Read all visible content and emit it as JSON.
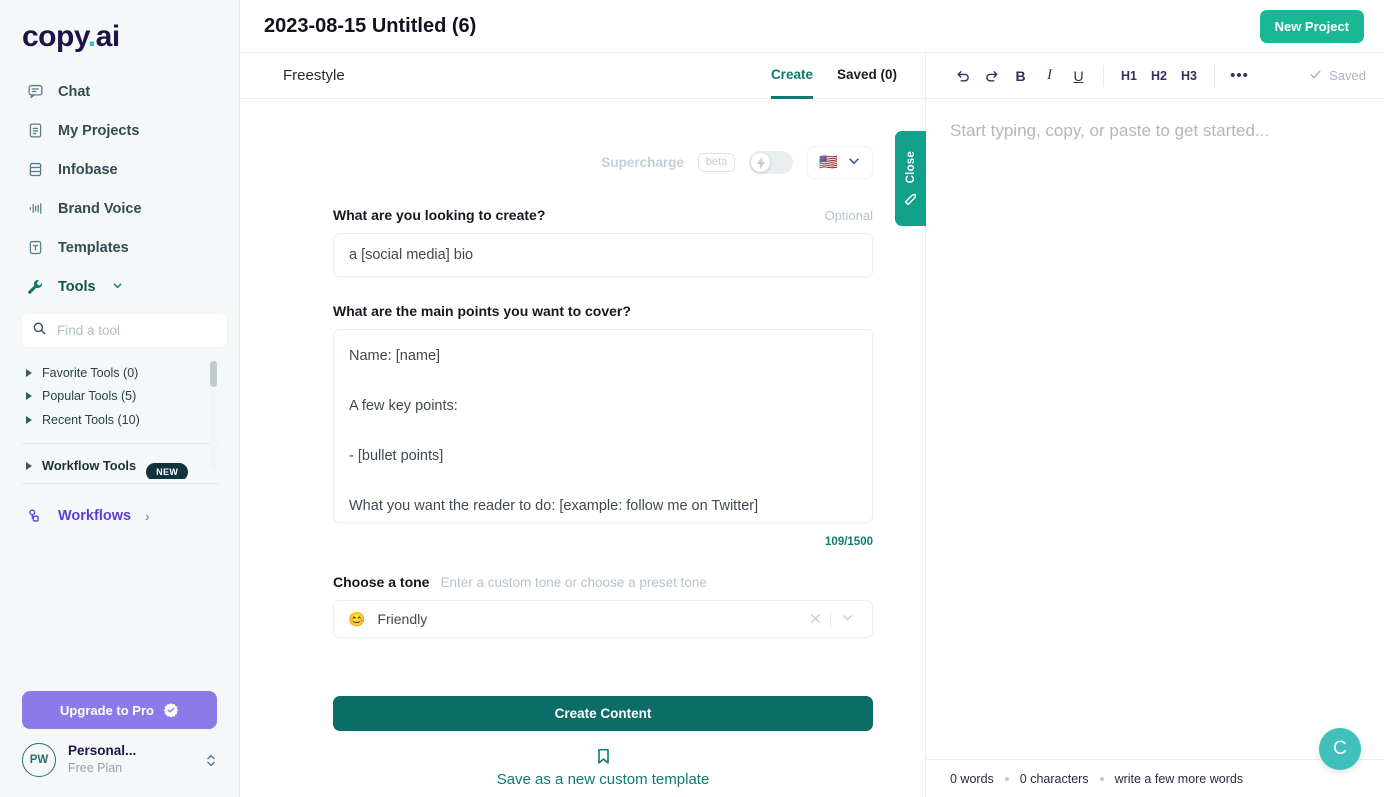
{
  "sidebar": {
    "logo_main": "copy",
    "logo_dot": ".",
    "logo_suffix": "ai",
    "nav": [
      {
        "label": "Chat",
        "icon": "chat-icon"
      },
      {
        "label": "My Projects",
        "icon": "document-icon"
      },
      {
        "label": "Infobase",
        "icon": "database-icon"
      },
      {
        "label": "Brand Voice",
        "icon": "waveform-icon"
      },
      {
        "label": "Templates",
        "icon": "template-icon"
      },
      {
        "label": "Tools",
        "icon": "wrench-icon"
      }
    ],
    "tool_search_placeholder": "Find a tool",
    "tool_groups": [
      "Favorite Tools (0)",
      "Popular Tools (5)",
      "Recent Tools (10)"
    ],
    "workflow_tools_label": "Workflow Tools",
    "workflow_tools_badge": "NEW",
    "workflows_label": "Workflows",
    "upgrade_label": "Upgrade to Pro",
    "account_name": "Personal...",
    "account_plan": "Free Plan",
    "account_initials": "PW"
  },
  "topbar": {
    "doc_title": "2023-08-15 Untitled (6)",
    "new_project_label": "New Project"
  },
  "form": {
    "mode_label": "Freestyle",
    "tabs": [
      {
        "label": "Create",
        "active": true
      },
      {
        "label": "Saved (0)",
        "active": false
      }
    ],
    "supercharge_label": "Supercharge",
    "supercharge_beta": "beta",
    "supercharge_on": false,
    "language_flag": "🇺🇸",
    "create_field_label": "What are you looking to create?",
    "create_field_optional": "Optional",
    "create_field_value": "a [social media] bio",
    "points_field_label": "What are the main points you want to cover?",
    "points_field_value": "Name: [name]\n\nA few key points:\n\n- [bullet points]\n\nWhat you want the reader to do: [example: follow me on Twitter]",
    "char_counter": "109/1500",
    "tone_label": "Choose a tone",
    "tone_hint": "Enter a custom tone or choose a preset tone",
    "tone_emoji": "😊",
    "tone_value": "Friendly",
    "create_button_label": "Create Content",
    "save_template_label": "Save as a new custom template",
    "close_tab_label": "Close"
  },
  "editor": {
    "toolbar": {
      "undo": "undo-icon",
      "redo": "redo-icon",
      "bold": "B",
      "italic": "I",
      "underline": "U",
      "h1": "H1",
      "h2": "H2",
      "h3": "H3",
      "more": "•••",
      "saved_label": "Saved"
    },
    "placeholder": "Start typing, copy, or paste to get started...",
    "footer": {
      "words": "0 words",
      "characters": "0 characters",
      "hint": "write a few more words"
    },
    "fab_label": "C"
  },
  "colors": {
    "brand_purple": "#1f1346",
    "teal_accent": "#0e7a72",
    "green_button": "#17b893",
    "upgrade_purple": "#8b7ae8",
    "workflow_purple": "#5b3fd6",
    "sidebar_bg": "#f4f8f9"
  }
}
